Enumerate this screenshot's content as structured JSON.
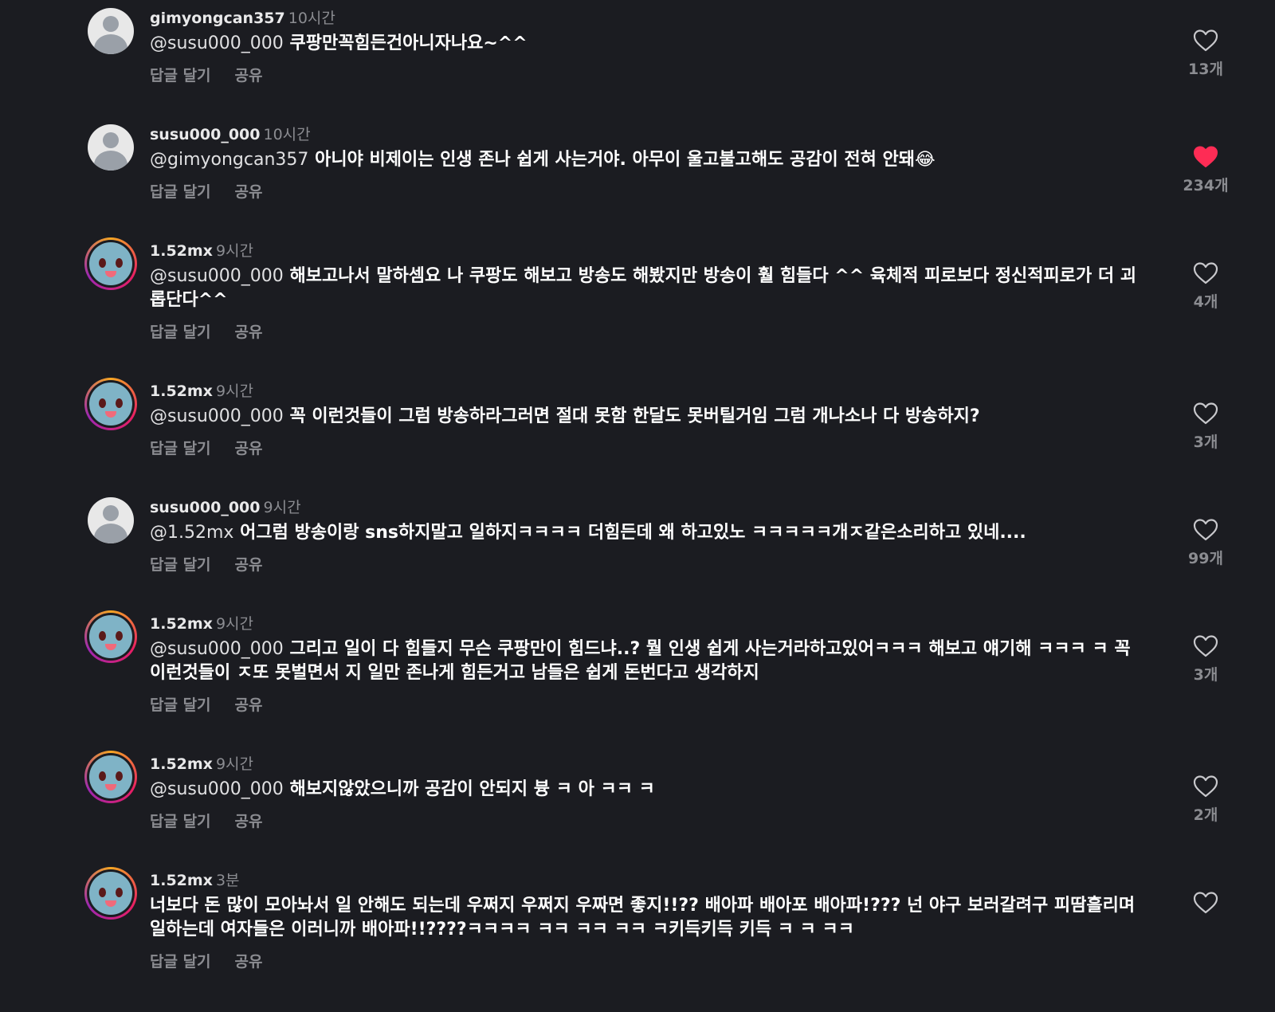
{
  "labels": {
    "reply": "답글 달기",
    "share": "공유"
  },
  "colors": {
    "background": "#1b1c21",
    "liked_heart": "#fe2c55",
    "muted_text": "#8b8c91"
  },
  "comments": [
    {
      "username": "gimyongcan357",
      "time": "10시간",
      "mention": "@susu000_000",
      "text": "쿠팡만꼭힘든건아니자나요~^^",
      "likes": "13개",
      "liked": false,
      "avatar": "default-avatar-icon"
    },
    {
      "username": "susu000_000",
      "time": "10시간",
      "mention": "@gimyongcan357",
      "text": "아니야 비제이는 인생 존나 쉽게 사는거야. 아무이 울고불고해도 공감이 전혀 안돼😂",
      "likes": "234개",
      "liked": true,
      "avatar": "default-avatar-icon"
    },
    {
      "username": "1.52mx",
      "time": "9시간",
      "mention": "@susu000_000",
      "text": "해보고나서 말하셈요 나 쿠팡도 해보고 방송도 해봤지만 방송이 훨 힘들다 ^^ 육체적 피로보다 정신적피로가 더 괴롭단다^^",
      "likes": "4개",
      "liked": false,
      "avatar": "character-avatar-icon"
    },
    {
      "username": "1.52mx",
      "time": "9시간",
      "mention": "@susu000_000",
      "text": "꼭 이런것들이 그럼 방송하라그러면 절대 못함 한달도 못버틸거임 그럼 개나소나 다 방송하지?",
      "likes": "3개",
      "liked": false,
      "avatar": "character-avatar-icon"
    },
    {
      "username": "susu000_000",
      "time": "9시간",
      "mention": "@1.52mx",
      "text": "어그럼 방송이랑 sns하지말고 일하지ㅋㅋㅋㅋ 더힘든데 왜 하고있노 ㅋㅋㅋㅋㅋ개ㅈ같은소리하고 있네....",
      "likes": "99개",
      "liked": false,
      "avatar": "default-avatar-icon"
    },
    {
      "username": "1.52mx",
      "time": "9시간",
      "mention": "@susu000_000",
      "text": "그리고 일이 다 힘들지 무슨 쿠팡만이 힘드냐..? 뭘 인생 쉽게 사는거라하고있어ㅋㅋㅋ 해보고 얘기해 ㅋㅋㅋ ㅋ 꼭 이런것들이 ㅈ또 못벌면서 지 일만 존나게 힘든거고 남들은 쉽게 돈번다고 생각하지",
      "likes": "3개",
      "liked": false,
      "avatar": "character-avatar-icon"
    },
    {
      "username": "1.52mx",
      "time": "9시간",
      "mention": "@susu000_000",
      "text": "해보지않았으니까 공감이 안되지 븅 ㅋ 아 ㅋㅋ ㅋ",
      "likes": "2개",
      "liked": false,
      "avatar": "character-avatar-icon"
    },
    {
      "username": "1.52mx",
      "time": "3분",
      "mention": "",
      "text": "너보다 돈 많이 모아놔서 일 안해도 되는데 우쩌지 우쩌지 우짜면 좋지!!?? 배아파 배아포 배아파!??? 넌 야구 보러갈려구 피땀흘리며 일하는데 여자들은 이러니까 배아파!!????ㅋㅋㅋㅋ ㅋㅋ ㅋㅋ ㅋㅋ ㅋ키득키득 키득 ㅋ ㅋ ㅋㅋ",
      "likes": "",
      "liked": false,
      "avatar": "character-avatar-icon"
    }
  ]
}
